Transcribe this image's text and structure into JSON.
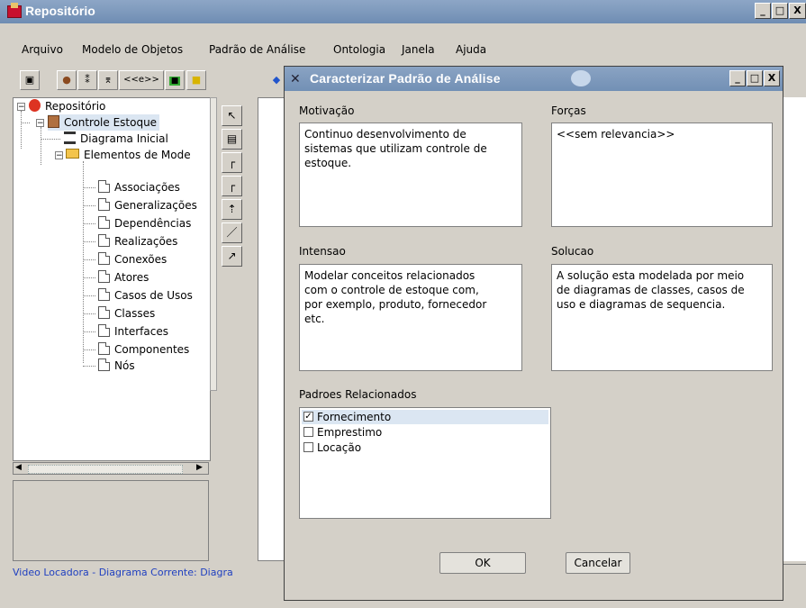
{
  "main_window": {
    "title": "Repositório"
  },
  "menu": [
    "Arquivo",
    "Modelo de Objetos",
    "Padrão de Análise",
    "Ontologia",
    "Janela",
    "Ajuda"
  ],
  "toolbar": {
    "element_label": "<<e>>"
  },
  "tree": {
    "root": "Repositório",
    "package": "Controle Estoque",
    "diagram": "Diagrama Inicial",
    "elements_folder": "Elementos de Mode",
    "items": [
      "Associações",
      "Generalizações",
      "Dependências",
      "Realizações",
      "Conexões",
      "Atores",
      "Casos de Usos",
      "Classes",
      "Interfaces",
      "Componentes",
      "Nós"
    ]
  },
  "statusbar": {
    "text": "Video Locadora - Diagrama Corrente: Diagra"
  },
  "dialog": {
    "title": "Caracterizar Padrão de Análise",
    "motivacao_label": "Motivação",
    "motivacao_text": "Continuo desenvolvimento de\nsistemas que utilizam controle de\nestoque.",
    "forcas_label": "Forças",
    "forcas_text": "<<sem relevancia>>",
    "intensao_label": "Intensao",
    "intensao_text": "Modelar conceitos relacionados\ncom o controle de estoque com,\npor exemplo, produto, fornecedor\netc.",
    "solucao_label": "Solucao",
    "solucao_text": "A solução esta modelada por meio\nde diagramas de classes, casos de\nuso e diagramas de sequencia.",
    "padroes_label": "Padroes Relacionados",
    "padroes": [
      {
        "label": "Fornecimento",
        "checked": true
      },
      {
        "label": "Emprestimo",
        "checked": false
      },
      {
        "label": "Locação",
        "checked": false
      }
    ],
    "ok_label": "OK",
    "cancel_label": "Cancelar"
  },
  "colors": {
    "titlebar": "#7a96bb",
    "status_text": "#2040c0",
    "selection": "#dbe6f2"
  }
}
